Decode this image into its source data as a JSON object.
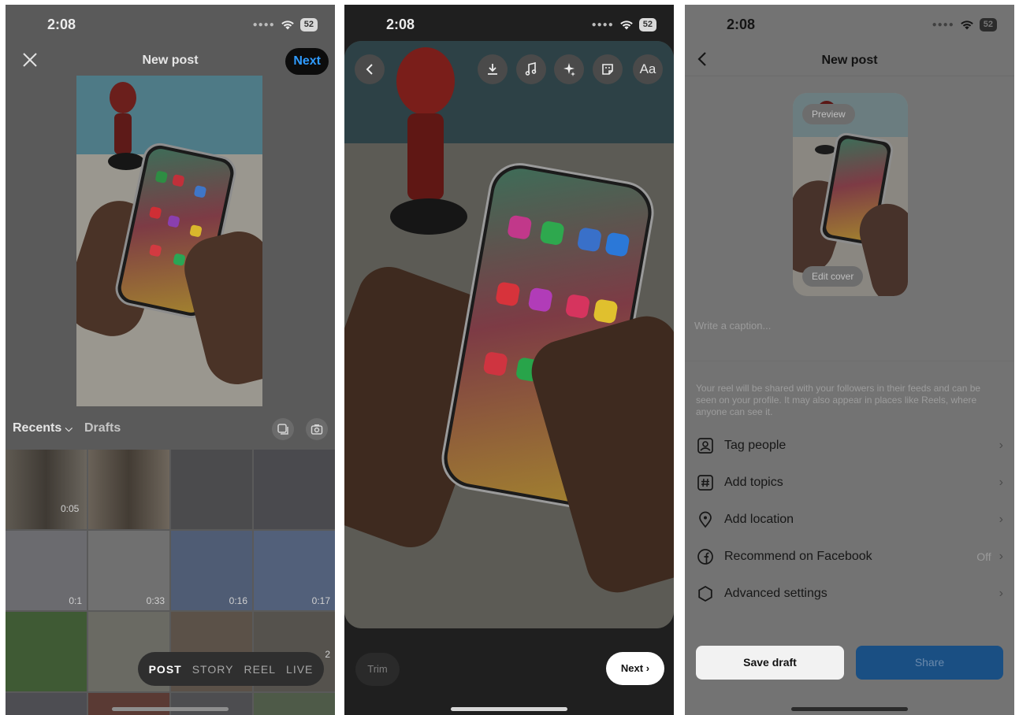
{
  "status": {
    "time": "2:08",
    "battery": "52"
  },
  "panel1": {
    "title": "New post",
    "next": "Next",
    "recents": "Recents",
    "drafts": "Drafts",
    "durations": [
      "0:05",
      "0:1",
      "0:33",
      "0:16",
      "0:17",
      "2"
    ],
    "modes": [
      "POST",
      "STORY",
      "REEL",
      "LIVE"
    ],
    "active_mode": "POST"
  },
  "panel2": {
    "tools": [
      "back-icon",
      "download-icon",
      "music-icon",
      "effects-icon",
      "sticker-icon",
      "text-icon"
    ],
    "text_tool": "Aa",
    "trim": "Trim",
    "next": "Next"
  },
  "panel3": {
    "title": "New post",
    "preview": "Preview",
    "edit_cover": "Edit cover",
    "caption_placeholder": "Write a caption...",
    "info": "Your reel will be shared with your followers in their feeds and can be seen on your profile. It may also appear in places like Reels, where anyone can see it.",
    "rows": [
      {
        "label": "Tag people",
        "value": "",
        "icon": "tag-person-icon"
      },
      {
        "label": "Add topics",
        "value": "",
        "icon": "hashtag-icon"
      },
      {
        "label": "Add location",
        "value": "",
        "icon": "location-icon"
      },
      {
        "label": "Recommend on Facebook",
        "value": "Off",
        "icon": "facebook-icon"
      },
      {
        "label": "Advanced settings",
        "value": "",
        "icon": "settings-icon"
      }
    ],
    "save_draft": "Save draft",
    "share": "Share"
  }
}
